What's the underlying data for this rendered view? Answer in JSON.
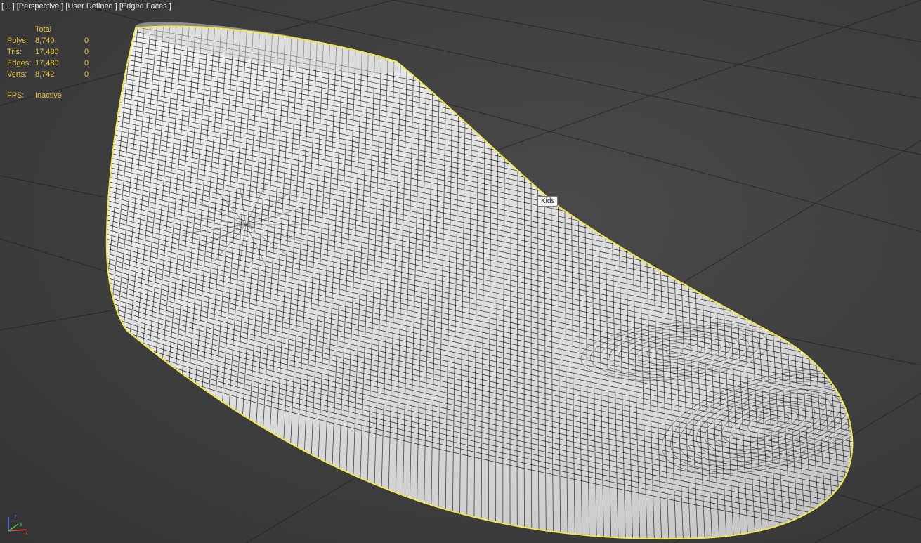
{
  "viewport": {
    "labels": [
      "[ + ]",
      "[Perspective ]",
      "[User Defined ]",
      "[Edged Faces ]"
    ]
  },
  "stats": {
    "header": "Total",
    "rows": [
      {
        "label": "Polys:",
        "total": "8,740",
        "selected": "0"
      },
      {
        "label": "Tris:",
        "total": "17,480",
        "selected": "0"
      },
      {
        "label": "Edges:",
        "total": "17,480",
        "selected": "0"
      },
      {
        "label": "Verts:",
        "total": "8,742",
        "selected": "0"
      }
    ],
    "fps_label": "FPS:",
    "fps_value": "Inactive"
  },
  "tooltip": "Kids",
  "axis": {
    "x": "x",
    "y": "y",
    "z": "z"
  },
  "colors": {
    "stats_text": "#e6c23e",
    "selection_outline": "#f2e64a",
    "mesh_fill": "#d8d8d8",
    "wire": "#1e1e1e",
    "grid": "#222222"
  }
}
